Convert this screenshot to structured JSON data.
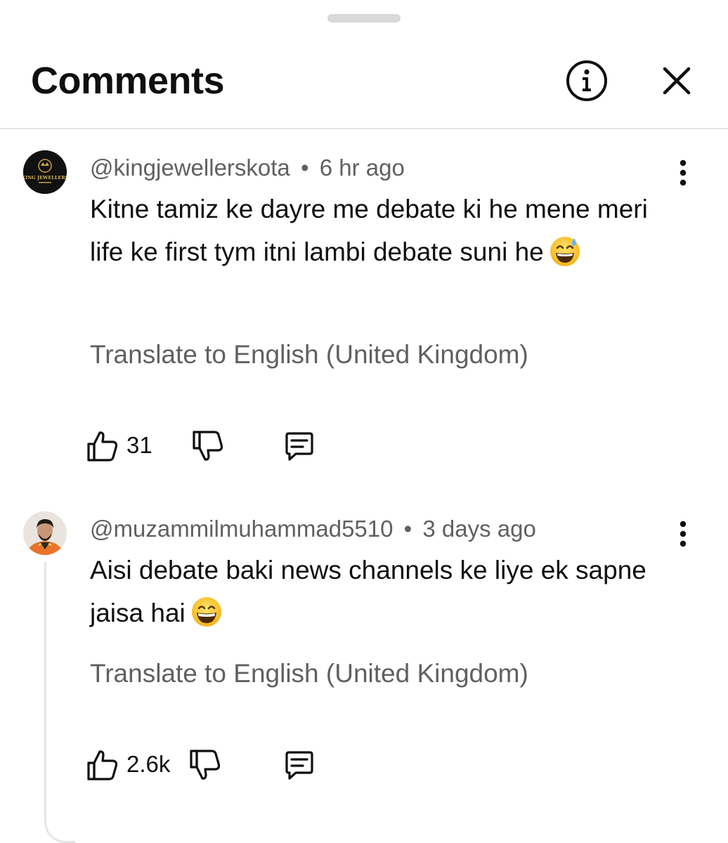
{
  "header": {
    "title": "Comments",
    "info_icon": "info-circle-icon",
    "close_icon": "close-icon"
  },
  "comments": [
    {
      "handle": "@kingjewellerskota",
      "separator": "•",
      "time": "6 hr ago",
      "avatar_text": "KING JEWELLERS",
      "text": "Kitne tamiz ke dayre me debate ki he mene meri life ke first tym itni lambi debate suni he",
      "emoji": "grinning-face-with-sweat-emoji",
      "translate": "Translate to English (United Kingdom)",
      "likes": "31",
      "icons": [
        "thumbs-up-icon",
        "thumbs-down-icon",
        "reply-icon",
        "more-vertical-icon"
      ]
    },
    {
      "handle": "@muzammilmuhammad5510",
      "separator": "•",
      "time": "3 days ago",
      "text": "Aisi debate baki news channels ke liye ek sapne jaisa hai",
      "emoji": "grinning-face-with-smiling-eyes-emoji",
      "translate": "Translate to English (United Kingdom)",
      "likes": "2.6k",
      "icons": [
        "thumbs-up-icon",
        "thumbs-down-icon",
        "reply-icon",
        "more-vertical-icon"
      ]
    }
  ],
  "colors": {
    "primary_text": "#0f0f0f",
    "secondary_text": "#606060",
    "divider": "#e5e5e5",
    "background": "#ffffff"
  }
}
